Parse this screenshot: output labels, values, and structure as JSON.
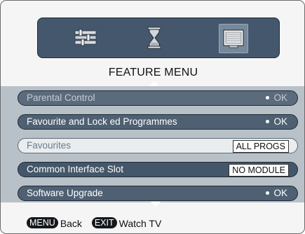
{
  "icons": [
    {
      "name": "settings-sliders-icon",
      "selected": false
    },
    {
      "name": "hourglass-timer-icon",
      "selected": false
    },
    {
      "name": "tv-screen-icon",
      "selected": true
    }
  ],
  "title": "FEATURE MENU",
  "items": [
    {
      "label": "Parental Control",
      "value": "OK",
      "value_type": "ok",
      "state": "disabled"
    },
    {
      "label": "Favourite and Lock ed Programmes",
      "value": "OK",
      "value_type": "ok",
      "state": "active"
    },
    {
      "label": "Favourites",
      "value": "ALL PROGS",
      "value_type": "box",
      "state": "highlighted"
    },
    {
      "label": "Common Interface Slot",
      "value": "NO MODULE",
      "value_type": "box",
      "state": "active"
    },
    {
      "label": "Software Upgrade",
      "value": "OK",
      "value_type": "ok",
      "state": "active"
    }
  ],
  "footer": {
    "back_key": "MENU",
    "back_label": "Back",
    "exit_key": "EXIT",
    "exit_label": "Watch TV"
  },
  "colors": {
    "icon_bar": "#44576c",
    "menu_panel": "#b9c1c8",
    "row_active": "#4e6072",
    "row_disabled": "#5b6b7c",
    "row_highlight": "#e9edf0"
  }
}
